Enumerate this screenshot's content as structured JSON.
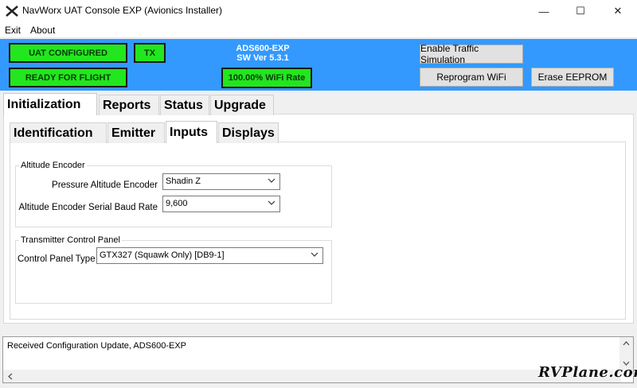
{
  "window": {
    "title": "NavWorx UAT Console EXP (Avionics Installer)",
    "controls": {
      "minimize": "—",
      "maximize": "☐",
      "close": "✕"
    }
  },
  "menu": {
    "items": [
      "Exit",
      "About"
    ]
  },
  "header": {
    "status_configured": "UAT CONFIGURED",
    "status_tx": "TX",
    "status_ready": "READY FOR FLIGHT",
    "model": "ADS600-EXP",
    "sw_version": "SW Ver 5.3.1",
    "wifi_rate": "100.00% WiFi Rate",
    "status_color": "#22e61e",
    "header_color": "#3399ff",
    "buttons": {
      "traffic_sim": "Enable Traffic Simulation",
      "reprogram_wifi": "Reprogram WiFi",
      "erase_eeprom": "Erase EEPROM"
    }
  },
  "tabs_main": [
    "Initialization",
    "Reports",
    "Status",
    "Upgrade"
  ],
  "tabs_main_active": "Initialization",
  "tabs_sub": [
    "Identification",
    "Emitter",
    "Inputs",
    "Displays"
  ],
  "tabs_sub_active": "Inputs",
  "altitude_encoder": {
    "legend": "Altitude Encoder",
    "pressure_label": "Pressure Altitude Encoder",
    "pressure_value": "Shadin Z",
    "baud_label": "Altitude Encoder Serial Baud Rate",
    "baud_value": "9,600"
  },
  "transmitter_panel": {
    "legend": "Transmitter Control Panel",
    "type_label": "Control Panel Type",
    "type_value": "GTX327 (Squawk Only) [DB9-1]"
  },
  "log": {
    "text": "Received Configuration Update, ADS600-EXP"
  },
  "watermark": "RVPlane.com"
}
